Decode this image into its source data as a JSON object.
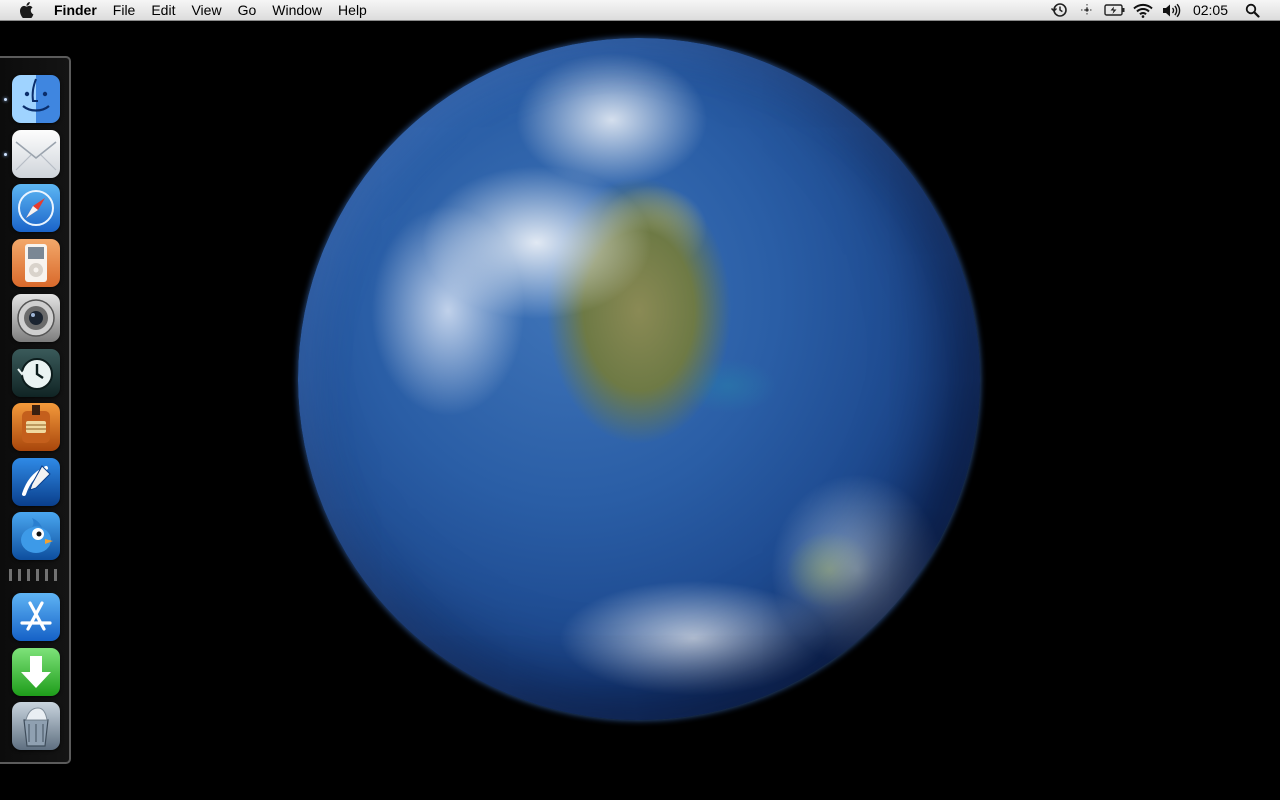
{
  "menubar": {
    "apple_icon": "apple-logo-icon",
    "app_name": "Finder",
    "menus": [
      "File",
      "Edit",
      "View",
      "Go",
      "Window",
      "Help"
    ],
    "status_icons": [
      "time-machine-icon",
      "network-activity-icon",
      "battery-charging-icon",
      "wifi-icon",
      "volume-icon"
    ],
    "clock": "02:05",
    "spotlight_icon": "spotlight-search-icon"
  },
  "desktop": {
    "wallpaper": "earth-globe"
  },
  "dock": {
    "position": "left",
    "items": [
      {
        "name": "finder",
        "icon": "finder-icon",
        "running": true
      },
      {
        "name": "mail",
        "icon": "mail-envelope-icon",
        "running": true
      },
      {
        "name": "safari",
        "icon": "safari-compass-icon",
        "running": false
      },
      {
        "name": "ipod",
        "icon": "ipod-icon",
        "running": false
      },
      {
        "name": "camera",
        "icon": "camera-lens-icon",
        "running": false
      },
      {
        "name": "time-machine",
        "icon": "time-machine-clock-icon",
        "running": false
      },
      {
        "name": "garageband",
        "icon": "guitar-icon",
        "running": false
      },
      {
        "name": "pen-app",
        "icon": "pen-icon",
        "running": false
      },
      {
        "name": "twitter",
        "icon": "bird-icon",
        "running": false
      },
      {
        "name": "app-store",
        "icon": "app-store-icon",
        "running": false
      },
      {
        "name": "downloads",
        "icon": "download-arrow-icon",
        "running": false
      },
      {
        "name": "trash",
        "icon": "trash-icon",
        "running": false
      }
    ]
  },
  "colors": {
    "menubar_top": "#f6f6f6",
    "menubar_bottom": "#dcdcdc",
    "desktop": "#000000",
    "dock_border": "#5b5b5b"
  }
}
